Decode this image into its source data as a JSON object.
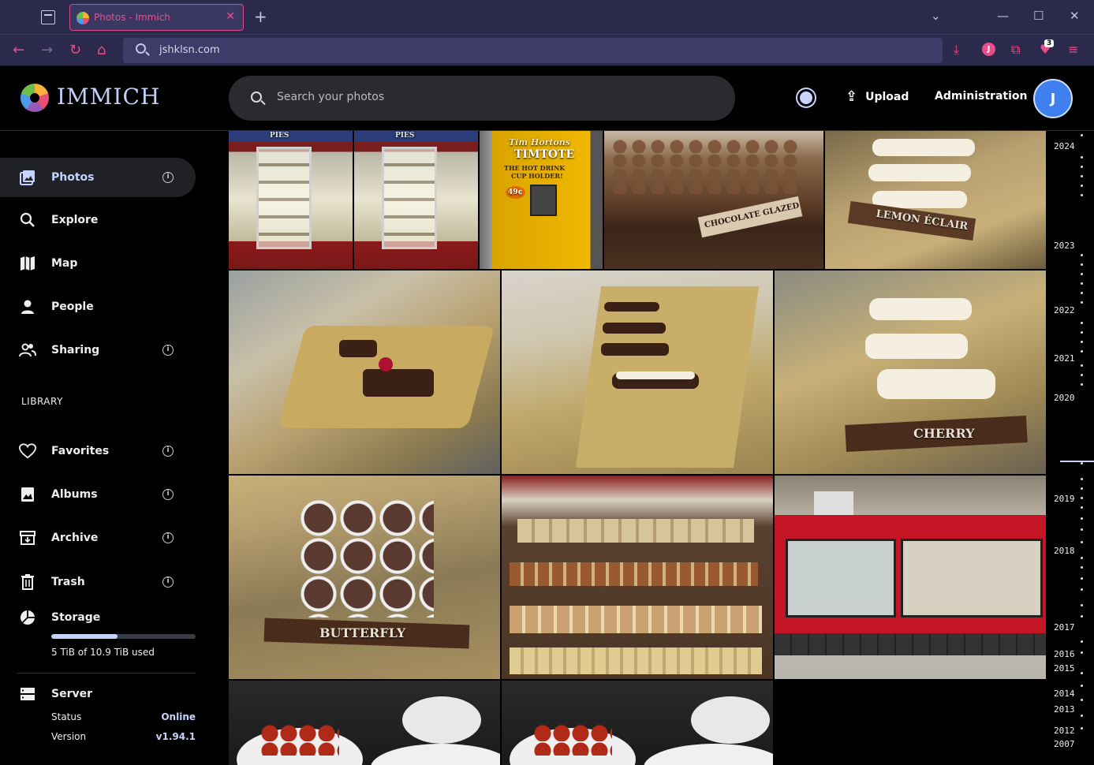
{
  "browser": {
    "tab_title": "Photos - Immich",
    "tab_close": "✕",
    "new_tab": "+",
    "url": "jshklsn.com",
    "extension_badge": "3",
    "profile_initial": "J"
  },
  "header": {
    "logo_text": "IMMICH",
    "search_placeholder": "Search your photos",
    "upload_label": "Upload",
    "administration_label": "Administration",
    "avatar_initial": "J"
  },
  "sidebar": {
    "items": [
      {
        "label": "Photos",
        "icon": "photos-icon",
        "active": true,
        "info": true
      },
      {
        "label": "Explore",
        "icon": "search-icon",
        "active": false,
        "info": false
      },
      {
        "label": "Map",
        "icon": "map-icon",
        "active": false,
        "info": false
      },
      {
        "label": "People",
        "icon": "person-icon",
        "active": false,
        "info": false
      },
      {
        "label": "Sharing",
        "icon": "people-icon",
        "active": false,
        "info": true
      }
    ],
    "library_label": "LIBRARY",
    "library_items": [
      {
        "label": "Favorites",
        "icon": "heart-icon",
        "info": true
      },
      {
        "label": "Albums",
        "icon": "album-icon",
        "info": true
      },
      {
        "label": "Archive",
        "icon": "archive-icon",
        "info": true
      },
      {
        "label": "Trash",
        "icon": "trash-icon",
        "info": true
      }
    ],
    "storage": {
      "label": "Storage",
      "used_text": "5 TiB of 10.9 TiB used",
      "used_fraction": 0.46
    },
    "server": {
      "label": "Server",
      "status_label": "Status",
      "status_value": "Online",
      "version_label": "Version",
      "version_value": "v1.94.1"
    }
  },
  "photos": [
    {
      "name": "photo-pies-display-case-1",
      "caption": "PIES"
    },
    {
      "name": "photo-pies-display-case-2",
      "caption": "PIES"
    },
    {
      "name": "photo-timtote-sign",
      "caption_lines": [
        "Tim Hortons",
        "TIMTOTE",
        "THE HOT DRINK",
        "CUP HOLDER!",
        "49¢"
      ]
    },
    {
      "name": "photo-chocolate-glazed",
      "caption": "CHOCOLATE GLAZED"
    },
    {
      "name": "photo-lemon-eclair",
      "caption": "LEMON ÉCLAIR"
    },
    {
      "name": "photo-pastry-tray",
      "caption": ""
    },
    {
      "name": "photo-eclair-tray",
      "caption": ""
    },
    {
      "name": "photo-cherry",
      "caption": "CHERRY"
    },
    {
      "name": "photo-butterfly",
      "caption": "BUTTERFLY"
    },
    {
      "name": "photo-cookie-shelves",
      "caption": ""
    },
    {
      "name": "photo-bakery-counter",
      "caption": ""
    },
    {
      "name": "photo-meatballs-1",
      "caption": ""
    },
    {
      "name": "photo-meatballs-2",
      "caption": ""
    }
  ],
  "timeline": {
    "years": [
      "2024",
      "2023",
      "2022",
      "2021",
      "2020",
      "2019",
      "2018",
      "2017",
      "2016",
      "2015",
      "2014",
      "2013",
      "2012",
      "2007"
    ]
  }
}
